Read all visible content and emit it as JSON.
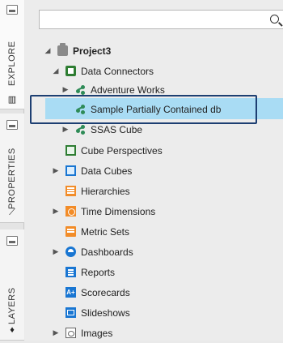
{
  "rail": {
    "tabs": [
      {
        "label": "EXPLORE"
      },
      {
        "label": "PROPERTIES"
      },
      {
        "label": "LAYERS"
      }
    ]
  },
  "search": {
    "value": "",
    "placeholder": ""
  },
  "tree": {
    "project": {
      "label": "Project3"
    },
    "data_connectors": {
      "label": "Data Connectors"
    },
    "adventure_works": {
      "label": "Adventure Works"
    },
    "sample_db": {
      "label": "Sample Partially Contained db"
    },
    "ssas_cube": {
      "label": "SSAS Cube"
    },
    "cube_perspectives": {
      "label": "Cube Perspectives"
    },
    "data_cubes": {
      "label": "Data Cubes"
    },
    "hierarchies": {
      "label": "Hierarchies"
    },
    "time_dimensions": {
      "label": "Time Dimensions"
    },
    "metric_sets": {
      "label": "Metric Sets"
    },
    "dashboards": {
      "label": "Dashboards"
    },
    "reports": {
      "label": "Reports"
    },
    "scorecards": {
      "label": "Scorecards",
      "icon_text": "A+"
    },
    "slideshows": {
      "label": "Slideshows"
    },
    "images": {
      "label": "Images"
    }
  },
  "colors": {
    "selection": "#a9dcf4",
    "highlight_border": "#1d3f72",
    "green": "#2e7d32",
    "blue": "#1976d2",
    "orange": "#f28c28"
  }
}
